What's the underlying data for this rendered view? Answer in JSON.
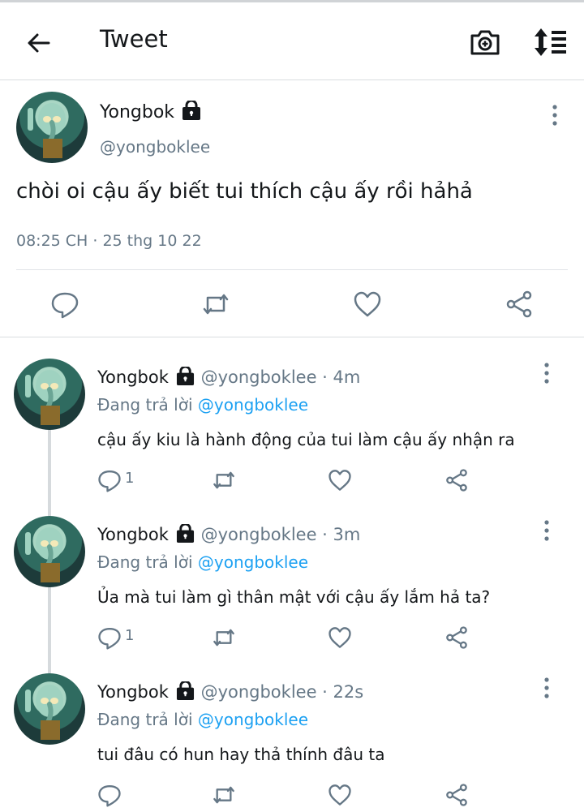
{
  "header": {
    "title": "Tweet",
    "icons": [
      "back-arrow-icon",
      "camera-plus-icon",
      "sort-icon"
    ]
  },
  "main_tweet": {
    "name": "Yongbok",
    "handle": "@yongboklee",
    "text": "chòi oi cậu ấy biết tui thích cậu ấy rồi hảhả",
    "time": "08:25 CH · 25 thg 10 22",
    "actions": [
      "reply-icon",
      "retweet-icon",
      "like-icon",
      "share-icon"
    ]
  },
  "replies": [
    {
      "name": "Yongbok",
      "meta": "@yongboklee · 4m",
      "replying_label": "Đang trả lời",
      "replying_to": "@yongboklee",
      "text": "cậu ấy kiu là hành động của tui làm cậu ấy nhận ra",
      "reply_count": "1"
    },
    {
      "name": "Yongbok",
      "meta": "@yongboklee · 3m",
      "replying_label": "Đang trả lời",
      "replying_to": "@yongboklee",
      "text": "Ủa mà tui làm gì thân mật với cậu ấy lắm hả ta?",
      "reply_count": "1"
    },
    {
      "name": "Yongbok",
      "meta": "@yongboklee · 22s",
      "replying_label": "Đang trả lời",
      "replying_to": "@yongboklee",
      "text": "tui đâu có hun hay thả thính đâu ta",
      "reply_count": ""
    }
  ],
  "colors": {
    "text": "#14171a",
    "secondary": "#657786",
    "link": "#1da1f2",
    "border": "#d9dde0"
  }
}
